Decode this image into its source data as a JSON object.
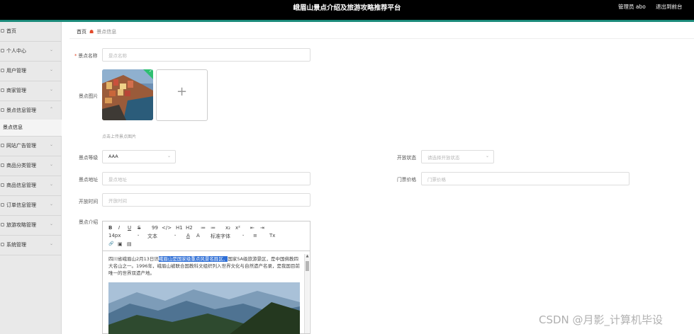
{
  "header": {
    "title": "峨眉山景点介绍及旅游攻略推荐平台",
    "user": "管理员 abo",
    "logout": "退出到前台"
  },
  "sidebar": {
    "items": [
      {
        "label": "首页",
        "caret": ""
      },
      {
        "label": "个人中心",
        "caret": "⌄"
      },
      {
        "label": "用户管理",
        "caret": "⌄"
      },
      {
        "label": "商家管理",
        "caret": "⌄"
      },
      {
        "label": "景点信息管理",
        "caret": "⌃"
      },
      {
        "label": "景点信息",
        "caret": ""
      },
      {
        "label": "网站广告管理",
        "caret": "⌄"
      },
      {
        "label": "商品分类管理",
        "caret": "⌄"
      },
      {
        "label": "商品信息管理",
        "caret": "⌄"
      },
      {
        "label": "订单信息管理",
        "caret": "⌄"
      },
      {
        "label": "旅游攻略管理",
        "caret": "⌄"
      },
      {
        "label": "系统管理",
        "caret": "⌄"
      }
    ]
  },
  "breadcrumb": {
    "home": "首页",
    "sep_icon": "home-icon",
    "current": "景点信息"
  },
  "form": {
    "name": {
      "label": "景点名称",
      "required": "*",
      "placeholder": "景点名称"
    },
    "image": {
      "label": "景点图片",
      "tip": "点击上传景点图片",
      "plus": "+"
    },
    "level": {
      "label": "景点等级",
      "value": "AAA",
      "caret": "⌄"
    },
    "status": {
      "label": "开放状态",
      "placeholder": "请选择开放状态",
      "caret": "⌄"
    },
    "address": {
      "label": "景点地址",
      "placeholder": "景点地址"
    },
    "price": {
      "label": "门票价格",
      "placeholder": "门票价格"
    },
    "hours": {
      "label": "开放时间",
      "placeholder": "开放时间"
    },
    "intro": {
      "label": "景点介绍"
    }
  },
  "editor": {
    "toolbar_row1": [
      "B",
      "I",
      "U",
      "S",
      "99",
      "</>",
      "H1",
      "H2",
      "≔",
      "≔",
      "x₂",
      "x²",
      "⇤",
      "⇥"
    ],
    "toolbar_row2": [
      "14px",
      "⌄",
      "文本",
      "⌄",
      "A",
      "A",
      "标准字体",
      "⌄",
      "≡",
      "Tx"
    ],
    "toolbar_row3": [
      "🔗",
      "▣",
      "▤"
    ],
    "content_pre": "四川省峨眉山2月13日讯",
    "content_highlight": "峨眉山是国家级重点风景名胜区、",
    "content_post": "国家5A级旅游景区，是中国佛教四大名山之一。1996年，峨眉山被联合国教科文组织列入世界文化与自然遗产名录，是我国目前唯一的世界双遗产地。"
  },
  "watermark": "CSDN @月影_计算机毕设",
  "colors": {
    "accent": "#1b8a7a",
    "required": "#e24a2b",
    "highlight": "#2f6fd6",
    "check": "#2fbf71"
  }
}
